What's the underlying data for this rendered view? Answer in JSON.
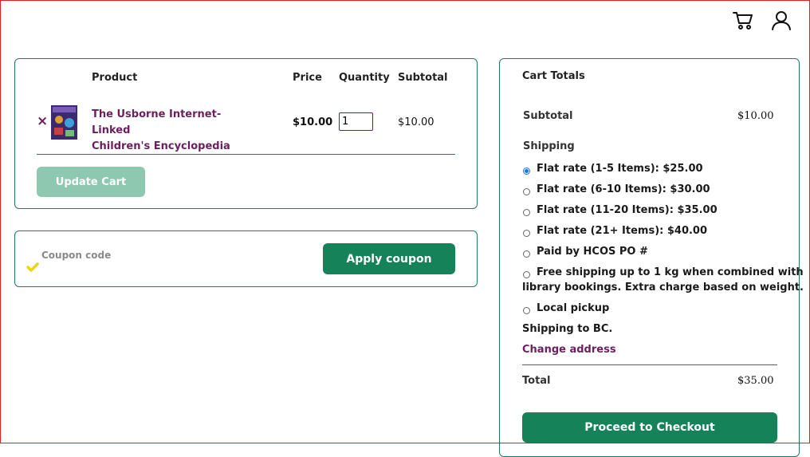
{
  "header": {
    "cart_icon": "cart-icon",
    "user_icon": "user-icon"
  },
  "cart": {
    "headers": {
      "product": "Product",
      "price": "Price",
      "quantity": "Quantity",
      "subtotal": "Subtotal"
    },
    "item": {
      "remove_glyph": "×",
      "thumbnail_icon": "book-cover-thumbnail",
      "name_line1": "The Usborne Internet-Linked",
      "name_line2": "Children's Encyclopedia",
      "price": "$10.00",
      "quantity": "1",
      "subtotal": "$10.00"
    },
    "update_button": "Update Cart"
  },
  "coupon": {
    "placeholder": "Coupon code",
    "apply_button": "Apply coupon"
  },
  "totals": {
    "title": "Cart Totals",
    "subtotal_label": "Subtotal",
    "subtotal_value": "$10.00",
    "shipping_label": "Shipping",
    "options": [
      {
        "label": "Flat rate (1-5 Items): ",
        "price": "$25.00",
        "selected": true
      },
      {
        "label": "Flat rate (6-10 Items): ",
        "price": "$30.00",
        "selected": false
      },
      {
        "label": "Flat rate (11-20 Items): ",
        "price": "$35.00",
        "selected": false
      },
      {
        "label": "Flat rate (21+ Items): ",
        "price": "$40.00",
        "selected": false
      },
      {
        "label": "Paid by HCOS PO #",
        "price": "",
        "selected": false
      },
      {
        "label": "Free shipping up to 1 kg when combined with",
        "label2": "library bookings. Extra charge based on weight.",
        "price": "",
        "selected": false
      },
      {
        "label": "Local pickup",
        "price": "",
        "selected": false
      }
    ],
    "shipping_to_prefix": "Shipping to ",
    "shipping_to_region": "BC",
    "shipping_to_suffix": ".",
    "change_address": "Change address",
    "total_label": "Total",
    "total_value": "$35.00",
    "checkout_button": "Proceed to Checkout"
  },
  "colors": {
    "accent": "#16825a",
    "border": "#1f7a6a",
    "link": "#6b1f5e",
    "radio": "#1a73e8"
  }
}
